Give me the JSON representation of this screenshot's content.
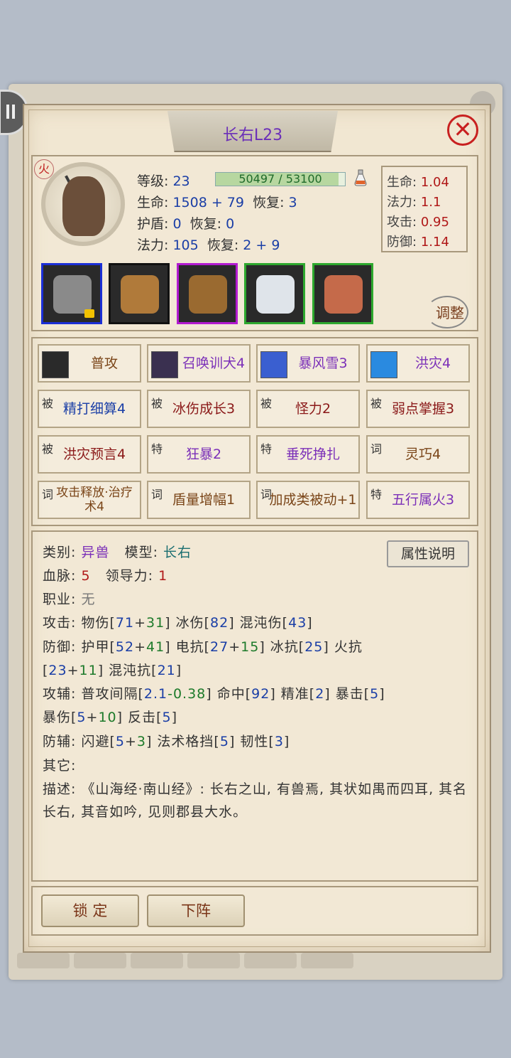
{
  "title": "长右L23",
  "element_badge": "火",
  "stats": {
    "level_label": "等级:",
    "level": "23",
    "exp_text": "50497 / 53100",
    "exp_fraction": 0.951,
    "hp_label": "生命:",
    "hp": "1508 + 79",
    "hp_recover_label": "恢复:",
    "hp_recover": "3",
    "shield_label": "护盾:",
    "shield": "0",
    "shield_recover_label": "恢复:",
    "shield_recover": "0",
    "mana_label": "法力:",
    "mana": "105",
    "mana_recover_label": "恢复:",
    "mana_recover": "2 + 9"
  },
  "growth": [
    {
      "label": "生命:",
      "value": "1.04"
    },
    {
      "label": "法力:",
      "value": "1.1"
    },
    {
      "label": "攻击:",
      "value": "0.95"
    },
    {
      "label": "防御:",
      "value": "1.14"
    }
  ],
  "equipment": [
    {
      "name": "axe-weapon",
      "border_color": "#1b2fd6",
      "color": "#8a8a8a",
      "locked": true
    },
    {
      "name": "fur-armor",
      "border_color": "#111111",
      "color": "#b07a3a",
      "locked": false
    },
    {
      "name": "boots",
      "border_color": "#b21ad0",
      "color": "#9a6a30",
      "locked": false
    },
    {
      "name": "claw-accessory",
      "border_color": "#2ea82e",
      "color": "#dfe4ea",
      "locked": false
    },
    {
      "name": "horse-mount",
      "border_color": "#2ea82e",
      "color": "#c56a4a",
      "locked": false
    }
  ],
  "adjust_label": "调整",
  "skills": [
    {
      "tag": "",
      "icon": "sword-icon",
      "icon_color": "#2a2a2a",
      "name": "普攻",
      "color": "#7a4518"
    },
    {
      "tag": "",
      "icon": "dog-icon",
      "icon_color": "#3a3050",
      "name": "召唤训犬4",
      "color": "#7b2fb8"
    },
    {
      "tag": "",
      "icon": "blizzard-icon",
      "icon_color": "#3a5fd0",
      "name": "暴风雪3",
      "color": "#7b2fb8"
    },
    {
      "tag": "",
      "icon": "flood-icon",
      "icon_color": "#2a8ae0",
      "name": "洪灾4",
      "color": "#7b2fb8"
    },
    {
      "tag": "被",
      "name": "精打细算4",
      "color": "#1a3ea6"
    },
    {
      "tag": "被",
      "name": "冰伤成长3",
      "color": "#8a1818"
    },
    {
      "tag": "被",
      "name": "怪力2",
      "color": "#8a1818"
    },
    {
      "tag": "被",
      "name": "弱点掌握3",
      "color": "#8a1818"
    },
    {
      "tag": "被",
      "name": "洪灾预言4",
      "color": "#8a1818"
    },
    {
      "tag": "特",
      "name": "狂暴2",
      "color": "#7b2fb8"
    },
    {
      "tag": "特",
      "name": "垂死挣扎",
      "color": "#7b2fb8"
    },
    {
      "tag": "词",
      "name": "灵巧4",
      "color": "#7a4518"
    },
    {
      "tag": "词",
      "name": "攻击释放·治疗术4",
      "color": "#7a4518",
      "small": true
    },
    {
      "tag": "词",
      "name": "盾量增幅1",
      "color": "#7a4518"
    },
    {
      "tag": "词",
      "name": "加成类被动+1",
      "color": "#7a4518"
    },
    {
      "tag": "特",
      "name": "五行属火3",
      "color": "#7b2fb8"
    }
  ],
  "attr_button": "属性说明",
  "info": {
    "category_label": "类别:",
    "category": "异兽",
    "model_label": "模型:",
    "model": "长右",
    "blood_label": "血脉:",
    "blood": "5",
    "lead_label": "领导力:",
    "lead": "1",
    "job_label": "职业:",
    "job": "无",
    "attack_label": "攻击:",
    "defense_label": "防御:",
    "atkaux_label": "攻辅:",
    "defaux_label": "防辅:",
    "other_label": "其它:",
    "desc_label": "描述:",
    "desc": "《山海经·南山经》: 长右之山, 有兽焉, 其状如禺而四耳, 其名长右, 其音如吟, 见则郡县大水。"
  },
  "attack_parts": [
    {
      "t": "物伤[",
      "c": ""
    },
    {
      "t": "71",
      "c": "blue"
    },
    {
      "t": "+",
      "c": ""
    },
    {
      "t": "31",
      "c": "green"
    },
    {
      "t": "] 冰伤[",
      "c": ""
    },
    {
      "t": "82",
      "c": "blue"
    },
    {
      "t": "] 混沌伤[",
      "c": ""
    },
    {
      "t": "43",
      "c": "blue"
    },
    {
      "t": "]",
      "c": ""
    }
  ],
  "defense_parts": [
    {
      "t": "护甲[",
      "c": ""
    },
    {
      "t": "52",
      "c": "blue"
    },
    {
      "t": "+",
      "c": ""
    },
    {
      "t": "41",
      "c": "green"
    },
    {
      "t": "] 电抗[",
      "c": ""
    },
    {
      "t": "27",
      "c": "blue"
    },
    {
      "t": "+",
      "c": ""
    },
    {
      "t": "15",
      "c": "green"
    },
    {
      "t": "] 冰抗[",
      "c": ""
    },
    {
      "t": "25",
      "c": "blue"
    },
    {
      "t": "] 火抗",
      "c": ""
    }
  ],
  "defense_parts2": [
    {
      "t": "[",
      "c": ""
    },
    {
      "t": "23",
      "c": "blue"
    },
    {
      "t": "+",
      "c": ""
    },
    {
      "t": "11",
      "c": "green"
    },
    {
      "t": "] 混沌抗[",
      "c": ""
    },
    {
      "t": "21",
      "c": "blue"
    },
    {
      "t": "]",
      "c": ""
    }
  ],
  "atkaux_parts": [
    {
      "t": "普攻间隔[",
      "c": ""
    },
    {
      "t": "2.1",
      "c": "blue"
    },
    {
      "t": "-0.38",
      "c": "green"
    },
    {
      "t": "] 命中[",
      "c": ""
    },
    {
      "t": "92",
      "c": "blue"
    },
    {
      "t": "] 精准[",
      "c": ""
    },
    {
      "t": "2",
      "c": "blue"
    },
    {
      "t": "] 暴击[",
      "c": ""
    },
    {
      "t": "5",
      "c": "blue"
    },
    {
      "t": "]",
      "c": ""
    }
  ],
  "atkaux_parts2": [
    {
      "t": "暴伤[",
      "c": ""
    },
    {
      "t": "5",
      "c": "blue"
    },
    {
      "t": "+",
      "c": ""
    },
    {
      "t": "10",
      "c": "green"
    },
    {
      "t": "] 反击[",
      "c": ""
    },
    {
      "t": "5",
      "c": "blue"
    },
    {
      "t": "]",
      "c": ""
    }
  ],
  "defaux_parts": [
    {
      "t": "闪避[",
      "c": ""
    },
    {
      "t": "5",
      "c": "blue"
    },
    {
      "t": "+",
      "c": ""
    },
    {
      "t": "3",
      "c": "green"
    },
    {
      "t": "] 法术格挡[",
      "c": ""
    },
    {
      "t": "5",
      "c": "blue"
    },
    {
      "t": "] 韧性[",
      "c": ""
    },
    {
      "t": "3",
      "c": "blue"
    },
    {
      "t": "]",
      "c": ""
    }
  ],
  "buttons": {
    "lock": "锁 定",
    "unseat": "下阵"
  }
}
